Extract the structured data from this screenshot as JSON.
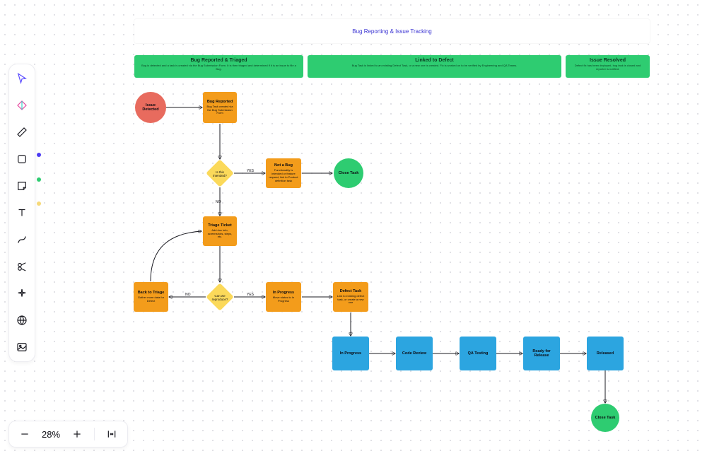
{
  "title": "Bug Reporting & Issue Tracking",
  "zoom": "28%",
  "phases": {
    "triage": {
      "title": "Bug Reported & Triaged",
      "desc": "Bug is detected and a task is created via the Bug Submission Form. It is then triaged and determined if it is an issue to file a Bug."
    },
    "linked": {
      "title": "Linked to Defect",
      "desc": "Bug Task is linked to an existing Defect Task, or a new one is created. Fix is worked on to be verified by Engineering and QA Teams."
    },
    "resolved": {
      "title": "Issue Resolved",
      "desc": "Defect fix has been deployed, bug task is closed and reporter is notified."
    }
  },
  "nodes": {
    "issue_detected": "Issue Detected",
    "bug_reported": {
      "t": "Bug Reported",
      "d": "Bug Task created via the Bug Submission Form"
    },
    "intended": "Is this intended?",
    "not_bug": {
      "t": "Not a Bug",
      "d": "Functionality is intended or feature request, link to Product definition task"
    },
    "close1": "Close Task",
    "triage_ticket": {
      "t": "Triage Ticket",
      "d": "Add doc info, screenshots, steps, etc."
    },
    "reproduce": "Can we reproduce?",
    "back_triage": {
      "t": "Back to Triage",
      "d": "Gather more data for Defect"
    },
    "inprog1": {
      "t": "In Progress",
      "d": "Move status to In Progress"
    },
    "defect_task": {
      "t": "Defect Task",
      "d": "Link to existing defect task, or create a new one"
    },
    "inprog2": "In Progress",
    "code_review": "Code Review",
    "qa_testing": "QA Testing",
    "ready": "Ready for Release",
    "released": "Released",
    "close2": "Close Task"
  },
  "edge_labels": {
    "yes1": "YES",
    "no1": "NO",
    "no2": "NO",
    "yes2": "YES"
  },
  "tool_names": {
    "pointer": "pointer",
    "assist": "ai-assist",
    "pen": "pen",
    "shape": "shape",
    "sticky": "sticky-note",
    "text": "text",
    "connector": "connector",
    "scissors": "section",
    "sparkle": "magic",
    "web": "embed",
    "image": "image"
  }
}
